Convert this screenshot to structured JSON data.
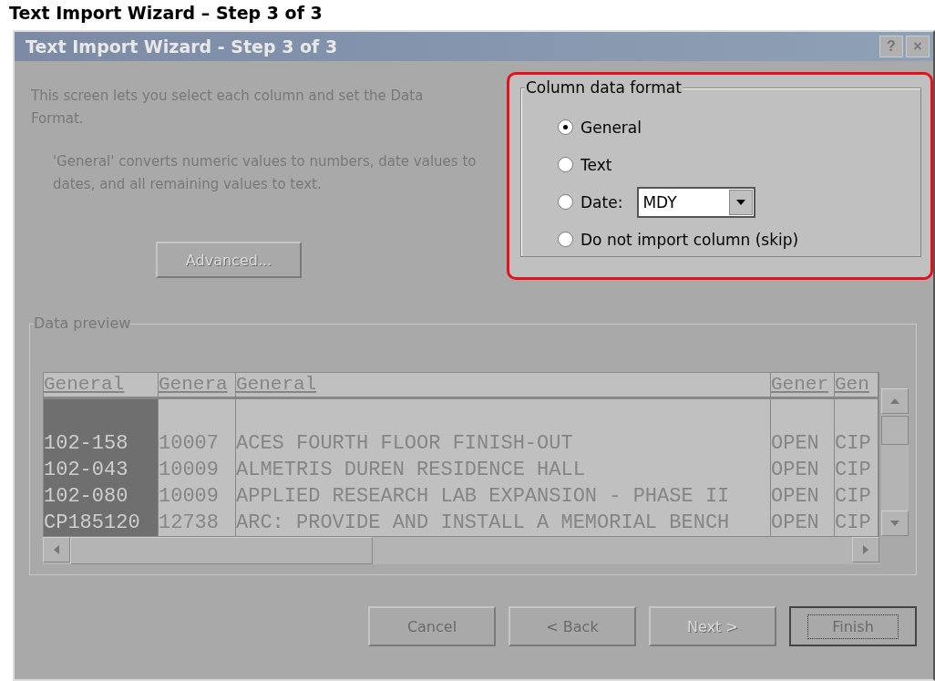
{
  "page_heading": "Text Import Wizard – Step 3 of 3",
  "window": {
    "title": "Text Import Wizard - Step 3 of 3",
    "disabled": true,
    "title_buttons": [
      "?",
      "×"
    ]
  },
  "intro": "This screen lets you select each column and set the Data Format.",
  "note": "'General' converts numeric values to numbers, date values to dates, and all remaining values to text.",
  "advanced_button": {
    "label": "Advanced...",
    "disabled": true
  },
  "column_data_format": {
    "title": "Column data format",
    "highlighted": true,
    "date_format": "MDY",
    "options": [
      {
        "label": "General",
        "selected": true,
        "kind": "radio"
      },
      {
        "label": "Text",
        "selected": false,
        "kind": "radio"
      },
      {
        "label": "Date:",
        "selected": false,
        "kind": "date"
      },
      {
        "label": "Do not import column (skip)",
        "selected": false,
        "kind": "radio"
      }
    ]
  },
  "data_preview": {
    "title": "Data preview",
    "columns": [
      {
        "label": "General",
        "selected": true
      },
      {
        "label": "Genera",
        "selected": false
      },
      {
        "label": "General",
        "selected": false
      },
      {
        "label": "Gener",
        "selected": false
      },
      {
        "label": "Gen",
        "selected": false
      }
    ],
    "rows": [
      [
        "102-158",
        "10007",
        "ACES FOURTH FLOOR FINISH-OUT",
        "OPEN",
        "CIP"
      ],
      [
        "102-043",
        "10009",
        "ALMETRIS DUREN RESIDENCE HALL",
        "OPEN",
        "CIP"
      ],
      [
        "102-080",
        "10009",
        "APPLIED RESEARCH LAB EXPANSION - PHASE II",
        "OPEN",
        "CIP"
      ],
      [
        "CP185120",
        "12738",
        "ARC: PROVIDE AND INSTALL A MEMORIAL BENCH",
        "OPEN",
        "CIP"
      ]
    ]
  },
  "buttons": [
    {
      "label": "Cancel",
      "disabled": false,
      "default": false
    },
    {
      "label": "< Back",
      "disabled": false,
      "default": false
    },
    {
      "label": "Next >",
      "disabled": true,
      "default": false
    },
    {
      "label": "Finish",
      "disabled": false,
      "default": true
    }
  ]
}
